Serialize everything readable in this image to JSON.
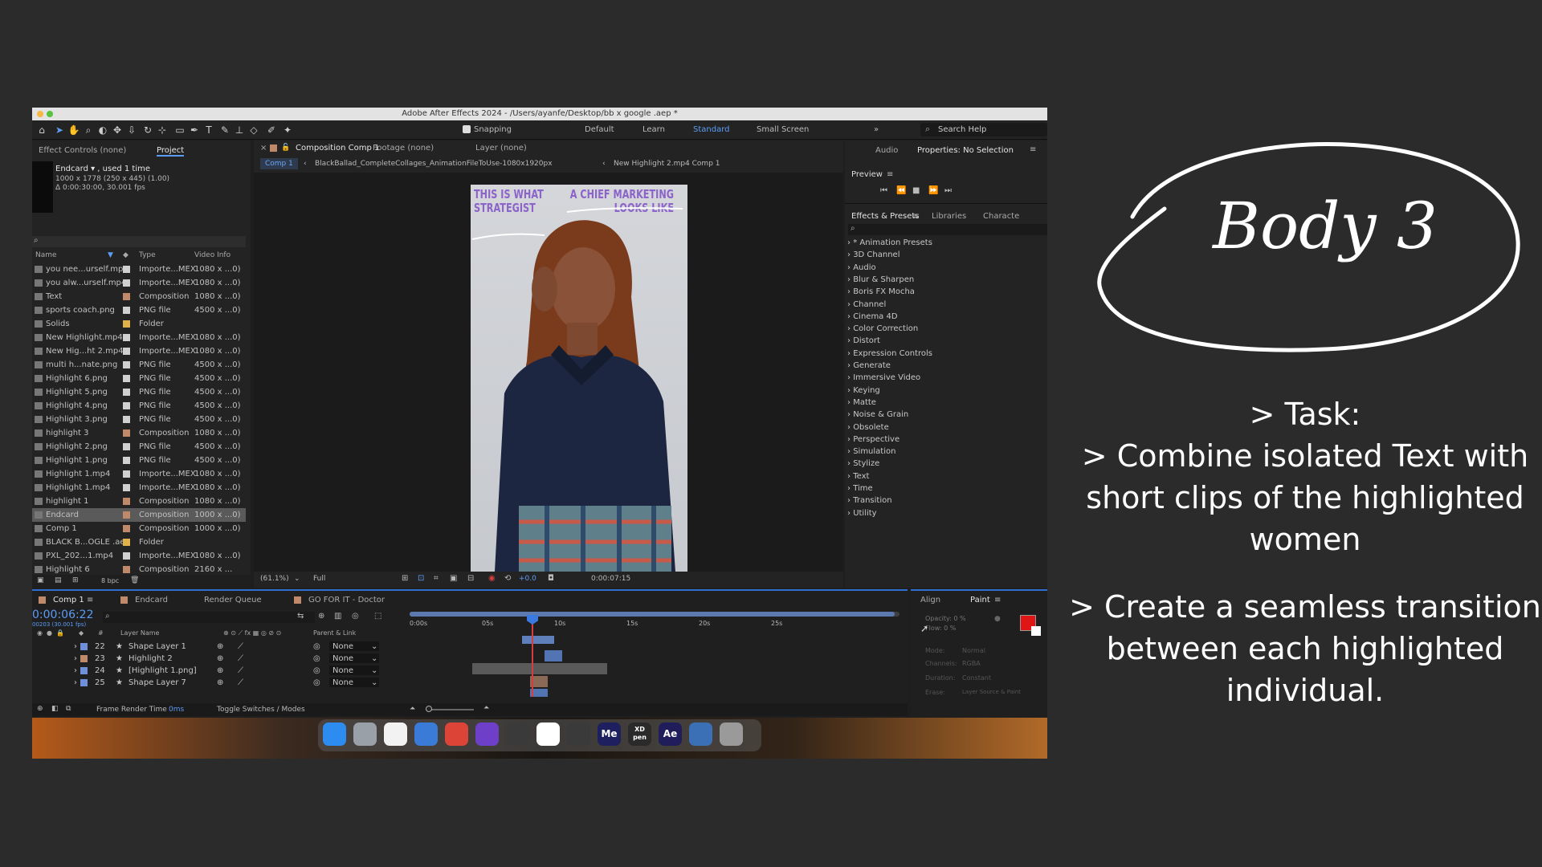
{
  "app": {
    "window_title": "Adobe After Effects 2024 - /Users/ayanfe/Desktop/bb x google .aep *",
    "toolbar": {
      "snapping_label": "Snapping",
      "workspaces": [
        "Default",
        "Learn",
        "Standard",
        "Small Screen"
      ],
      "active_workspace": "Standard",
      "search_help": "Search Help",
      "more": "»"
    }
  },
  "left_panel": {
    "tabs": [
      "Effect Controls (none)",
      "Project"
    ],
    "active_tab": "Project",
    "selected_item": {
      "name": "Endcard ▾ , used 1 time",
      "line1": "1000 x 1778  (250 x 445) (1.00)",
      "line2": "Δ 0:00:30:00, 30.001 fps"
    },
    "columns": [
      "Name",
      "Type",
      "Video Info"
    ],
    "items": [
      {
        "name": "you nee...urself.mp4",
        "type": "Importe...MEX",
        "info": "1080 x ...0)",
        "label": "#d0d0d0"
      },
      {
        "name": "you alw...urself.mp4",
        "type": "Importe...MEX",
        "info": "1080 x ...0)",
        "label": "#d0d0d0"
      },
      {
        "name": "Text",
        "type": "Composition",
        "info": "1080 x ...0)",
        "label": "#c0896a"
      },
      {
        "name": "sports coach.png",
        "type": "PNG file",
        "info": "4500 x ...0)",
        "label": "#d0d0d0"
      },
      {
        "name": "Solids",
        "type": "Folder",
        "info": "",
        "label": "#e0b04a"
      },
      {
        "name": "New Highlight.mp4",
        "type": "Importe...MEX",
        "info": "1080 x ...0)",
        "label": "#d0d0d0"
      },
      {
        "name": "New Hig...ht 2.mp4",
        "type": "Importe...MEX",
        "info": "1080 x ...0)",
        "label": "#d0d0d0"
      },
      {
        "name": "multi h...nate.png",
        "type": "PNG file",
        "info": "4500 x ...0)",
        "label": "#d0d0d0"
      },
      {
        "name": "Highlight 6.png",
        "type": "PNG file",
        "info": "4500 x ...0)",
        "label": "#d0d0d0"
      },
      {
        "name": "Highlight 5.png",
        "type": "PNG file",
        "info": "4500 x ...0)",
        "label": "#d0d0d0"
      },
      {
        "name": "Highlight 4.png",
        "type": "PNG file",
        "info": "4500 x ...0)",
        "label": "#d0d0d0"
      },
      {
        "name": "Highlight 3.png",
        "type": "PNG file",
        "info": "4500 x ...0)",
        "label": "#d0d0d0"
      },
      {
        "name": "highlight 3",
        "type": "Composition",
        "info": "1080 x ...0)",
        "label": "#c0896a"
      },
      {
        "name": "Highlight 2.png",
        "type": "PNG file",
        "info": "4500 x ...0)",
        "label": "#d0d0d0"
      },
      {
        "name": "Highlight 1.png",
        "type": "PNG file",
        "info": "4500 x ...0)",
        "label": "#d0d0d0"
      },
      {
        "name": "Highlight 1.mp4",
        "type": "Importe...MEX",
        "info": "1080 x ...0)",
        "label": "#d0d0d0"
      },
      {
        "name": "Highlight 1.mp4",
        "type": "Importe...MEX",
        "info": "1080 x ...0)",
        "label": "#d0d0d0"
      },
      {
        "name": "highlight 1",
        "type": "Composition",
        "info": "1080 x ...0)",
        "label": "#c0896a"
      },
      {
        "name": "Endcard",
        "type": "Composition",
        "info": "1000 x ...0)",
        "label": "#c0896a",
        "selected": true
      },
      {
        "name": "Comp 1",
        "type": "Composition",
        "info": "1000 x ...0)",
        "label": "#c0896a"
      },
      {
        "name": "BLACK B...OGLE .aep",
        "type": "Folder",
        "info": "",
        "label": "#e0b04a"
      },
      {
        "name": "PXL_202...1.mp4",
        "type": "Importe...MEX",
        "info": "1080 x ...0)",
        "label": "#d0d0d0"
      },
      {
        "name": "Highlight 6",
        "type": "Composition",
        "info": "2160 x ...",
        "label": "#c0896a"
      }
    ],
    "bpc": "8 bpc"
  },
  "composition_panel": {
    "tabs": [
      "Composition Comp 1",
      "Footage (none)",
      "Layer (none)"
    ],
    "breadcrumbs": [
      "Comp 1",
      "BlackBallad_CompleteCollages_AnimationFileToUse-1080x1920px",
      "New Highlight 2.mp4 Comp 1"
    ],
    "overlay_text_left": "THIS IS WHAT\nSTRATEGIST",
    "overlay_text_right": "A CHIEF MARKETING\nLOOKS LIKE",
    "zoom": "(61.1%)",
    "resolution": "Full",
    "exposure": "+0.0",
    "timecode": "0:00:07:15"
  },
  "right_panel": {
    "tabs": [
      "Audio",
      "Properties: No Selection"
    ],
    "preview_label": "Preview",
    "effects_tabs": [
      "Effects & Presets",
      "Libraries",
      "Characte"
    ],
    "effects": [
      "* Animation Presets",
      "3D Channel",
      "Audio",
      "Blur & Sharpen",
      "Boris FX Mocha",
      "Channel",
      "Cinema 4D",
      "Color Correction",
      "Distort",
      "Expression Controls",
      "Generate",
      "Immersive Video",
      "Keying",
      "Matte",
      "Noise & Grain",
      "Obsolete",
      "Perspective",
      "Simulation",
      "Stylize",
      "Text",
      "Time",
      "Transition",
      "Utility"
    ]
  },
  "timeline": {
    "tabs": [
      "Comp 1",
      "Endcard",
      "Render Queue",
      "GO FOR IT - Doctor"
    ],
    "current_time": "0:00:06:22",
    "frames": "00203 (30.001 fps)",
    "ruler": [
      "0:00s",
      "05s",
      "10s",
      "15s",
      "20s",
      "25s"
    ],
    "column_header": "Layer Name",
    "parent_header": "Parent & Link",
    "layers": [
      {
        "num": "22",
        "name": "Shape Layer 1",
        "parent": "None",
        "color": "#6f8fd8"
      },
      {
        "num": "23",
        "name": "Highlight 2",
        "parent": "None",
        "color": "#c0896a"
      },
      {
        "num": "24",
        "name": "[Highlight 1.png]",
        "parent": "None",
        "color": "#6f8fd8"
      },
      {
        "num": "25",
        "name": "Shape Layer 7",
        "parent": "None",
        "color": "#6f8fd8"
      }
    ],
    "footer_left": "Frame Render Time",
    "footer_value": "0ms",
    "footer_right": "Toggle Switches / Modes"
  },
  "paint_panel": {
    "tabs": [
      "Align",
      "Paint"
    ],
    "opacity": "Opacity: 0 %",
    "flow": "Flow: 0 %",
    "mode": "Mode:",
    "mode_value": "Normal",
    "channels": "Channels:",
    "channels_value": "RGBA",
    "duration": "Duration:",
    "duration_value": "Constant",
    "erase": "Erase:",
    "erase_value": "Layer Source & Paint",
    "fg_color": "#e01515"
  },
  "dock": {
    "icons": [
      {
        "name": "finder-icon",
        "label": "",
        "color": "#2d8cf0"
      },
      {
        "name": "launchpad-icon",
        "label": "",
        "color": "#9aa0a8"
      },
      {
        "name": "notes-icon",
        "label": "",
        "color": "#f2f2f2"
      },
      {
        "name": "preview-icon",
        "label": "",
        "color": "#3b7bd8"
      },
      {
        "name": "chrome-icon",
        "label": "",
        "color": "#db4437"
      },
      {
        "name": "github-icon",
        "label": "",
        "color": "#6e40c9"
      },
      {
        "name": "sublime-icon",
        "label": "",
        "color": "#3a3a3a"
      },
      {
        "name": "slack-icon",
        "label": "",
        "color": "#ffffff"
      },
      {
        "name": "blender-icon",
        "label": "",
        "color": "#3a3a3a"
      },
      {
        "name": "media-encoder-icon",
        "label": "Me",
        "color": "#1e1f5e"
      },
      {
        "name": "xd-pen-icon",
        "label": "XD pen",
        "color": "#2a2a2a"
      },
      {
        "name": "after-effects-icon",
        "label": "Ae",
        "color": "#1f1e5b"
      },
      {
        "name": "quicktime-icon",
        "label": "",
        "color": "#3b6fb6"
      },
      {
        "name": "trash-icon",
        "label": "",
        "color": "#9a9a9a"
      }
    ]
  },
  "slide": {
    "badge_title": "Body 3",
    "task_heading": "> Task:",
    "task_line1": "> Combine isolated Text with short clips of the highlighted women",
    "task_line2": "> Create a seamless transition between each highlighted individual."
  }
}
